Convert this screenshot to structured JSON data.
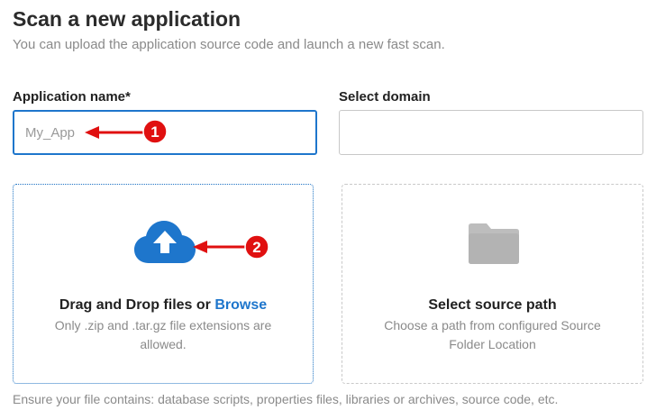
{
  "header": {
    "title": "Scan a new application",
    "subtitle": "You can upload the application source code and launch a new fast scan."
  },
  "form": {
    "app_name_label": "Application name*",
    "app_name_placeholder": "My_App",
    "domain_label": "Select domain"
  },
  "upload": {
    "title_prefix": "Drag and Drop files or",
    "browse_label": "Browse",
    "description": "Only .zip and .tar.gz file extensions are allowed.",
    "icon": "cloud-upload-icon",
    "accent": "#1e76cc"
  },
  "source_path": {
    "title": "Select source path",
    "description": "Choose a path from configured Source Folder Location",
    "icon": "folder-icon"
  },
  "footer_hint": "Ensure your file contains: database scripts, properties files, libraries or archives, source code, etc.",
  "annotations": {
    "marker_1": "1",
    "marker_2": "2",
    "color": "#e01010"
  }
}
